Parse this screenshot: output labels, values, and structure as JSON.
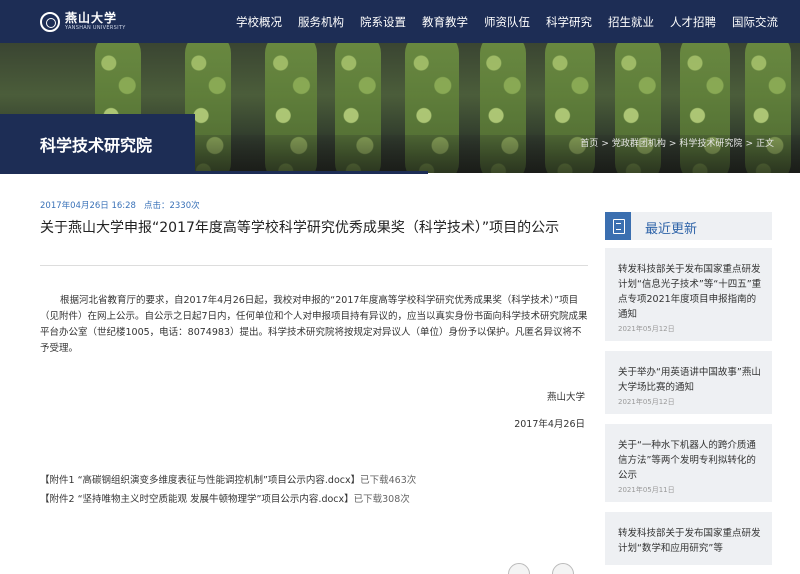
{
  "header": {
    "logo_cn": "燕山大学",
    "logo_en": "YANSHAN UNIVERSITY",
    "nav": [
      "学校概况",
      "服务机构",
      "院系设置",
      "教育教学",
      "师资队伍",
      "科学研究",
      "招生就业",
      "人才招聘",
      "国际交流"
    ]
  },
  "banner": {
    "section_title": "科学技术研究院",
    "breadcrumb": [
      "首页",
      "党政群团机构",
      "科学技术研究院",
      "正文"
    ],
    "breadcrumb_sep": ">"
  },
  "article": {
    "date": "2017年04月26日 16:28",
    "views": "点击：2330次",
    "title": "关于燕山大学申报“2017年度高等学校科学研究优秀成果奖（科学技术）”项目的公示",
    "body": "根据河北省教育厅的要求，自2017年4月26日起，我校对申报的“2017年度高等学校科学研究优秀成果奖（科学技术）”项目（见附件）在网上公示。自公示之日起7日内，任何单位和个人对申报项目持有异议的，应当以真实身份书面向科学技术研究院成果平台办公室（世纪楼1005，电话：8074983）提出。科学技术研究院将按规定对异议人（单位）身份予以保护。凡匿名异议将不予受理。",
    "sign_org": "燕山大学",
    "sign_date": "2017年4月26日",
    "attachments": [
      {
        "name": "【附件1 “高碳钢组织演变多维度表征与性能调控机制”项目公示内容.docx】",
        "count": "已下载463次"
      },
      {
        "name": "【附件2 “坚持唯物主义时空质能观 发展牛顿物理学”项目公示内容.docx】",
        "count": "已下载308次"
      }
    ]
  },
  "sidebar": {
    "heading": "最近更新",
    "items": [
      {
        "title": "转发科技部关于发布国家重点研发计划“信息光子技术”等“十四五”重点专项2021年度项目申报指南的通知",
        "date": "2021年05月12日"
      },
      {
        "title": "关于举办“用英语讲中国故事”燕山大学场比赛的通知",
        "date": "2021年05月12日"
      },
      {
        "title": "关于“一种水下机器人的跨介质通信方法”等两个发明专利拟转化的公示",
        "date": "2021年05月11日"
      },
      {
        "title": "转发科技部关于发布国家重点研发计划“数学和应用研究”等",
        "date": ""
      }
    ]
  },
  "colors": {
    "nav_bg": "#1d2d55",
    "accent_blue": "#2e63a8",
    "meta_blue": "#3a72b8",
    "sidebar_bg": "#eef0f3"
  },
  "icons": [
    "seal-logo-icon",
    "news-list-icon",
    "share-icon"
  ]
}
